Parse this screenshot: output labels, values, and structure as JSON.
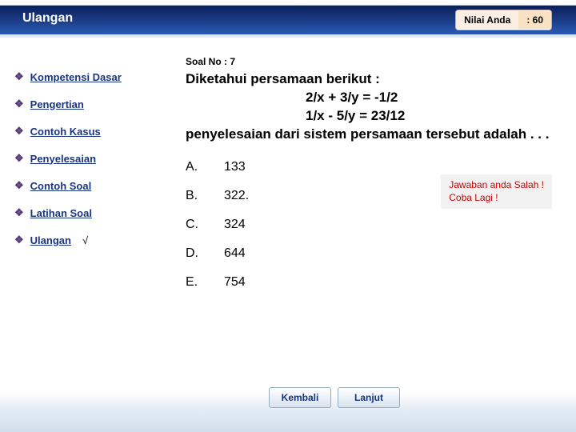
{
  "header": {
    "title": "Ulangan",
    "score_label": "Nilai Anda",
    "score_value": ": 60"
  },
  "sidebar": {
    "items": [
      {
        "label": "Kompetensi Dasar",
        "active": false
      },
      {
        "label": "Pengertian",
        "active": false
      },
      {
        "label": "Contoh Kasus",
        "active": false
      },
      {
        "label": "Penyelesaian",
        "active": false
      },
      {
        "label": "Contoh Soal",
        "active": false
      },
      {
        "label": "Latihan Soal",
        "active": false
      },
      {
        "label": "Ulangan",
        "active": true,
        "mark": "√"
      }
    ]
  },
  "question": {
    "number_label": "Soal No : 7",
    "intro": "Diketahui persamaan berikut :",
    "line1": "2/x + 3/y = -1/2",
    "line2": "1/x - 5/y  = 23/12",
    "outro": "penyelesaian dari sistem persamaan tersebut adalah . . ."
  },
  "options": [
    {
      "letter": "A.",
      "value": "133"
    },
    {
      "letter": "B.",
      "value": "322."
    },
    {
      "letter": "C.",
      "value": "324"
    },
    {
      "letter": "D.",
      "value": "644"
    },
    {
      "letter": "E.",
      "value": "754"
    }
  ],
  "feedback": {
    "line1": "Jawaban anda Salah !",
    "line2": "Coba Lagi !"
  },
  "nav": {
    "back": "Kembali",
    "next": "Lanjut"
  }
}
